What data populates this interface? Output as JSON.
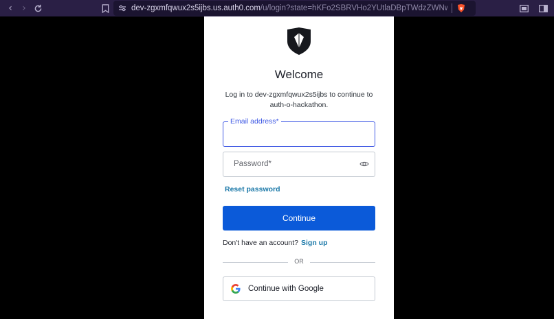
{
  "browser": {
    "url_host": "dev-zgxmfqwux2s5ijbs.us.auth0.com",
    "url_path": "/u/login?state=hKFo2SBRVHo2YUtlaDBpTWdzZWNwWDE2YTNkb0tvY..."
  },
  "login": {
    "title": "Welcome",
    "subtitle": "Log in to dev-zgxmfqwux2s5ijbs to continue to auth-o-hackathon.",
    "email_label": "Email address",
    "password_placeholder": "Password",
    "required_mark": "*",
    "reset_password": "Reset password",
    "continue_button": "Continue",
    "no_account_text": "Don't have an account?",
    "sign_up_link": "Sign up",
    "or_text": "OR",
    "google_button": "Continue with Google"
  },
  "colors": {
    "primary": "#0b5ad9",
    "link": "#1a78a8",
    "focus": "#3f59e4"
  }
}
